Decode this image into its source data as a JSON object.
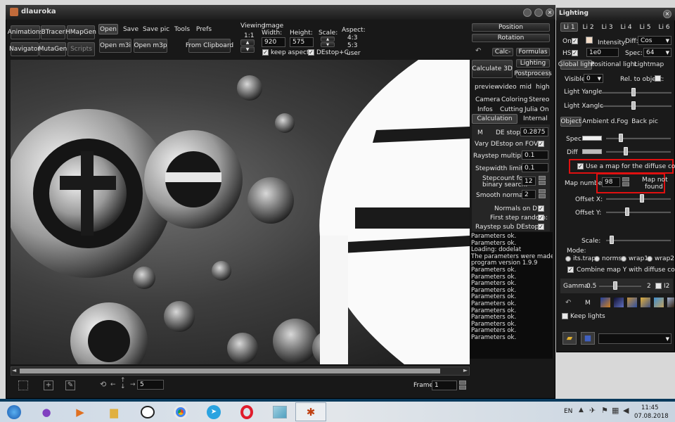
{
  "main": {
    "title": "dlauroka",
    "left_buttons": [
      "Animations",
      "BTracer",
      "HMapGen",
      "Navigator",
      "MutaGen",
      "Scripts"
    ],
    "menu": [
      "Open",
      "Save",
      "Save pic",
      "Tools",
      "Prefs"
    ],
    "open_m3i": "Open m3i",
    "open_m3p": "Open m3p",
    "clipboard": "From Clipboard",
    "viewing": "Viewing",
    "ratio": "1:1",
    "image": "Image",
    "width_lbl": "Width:",
    "width": "920",
    "height_lbl": "Height:",
    "height": "575",
    "scale_lbl": "Scale:",
    "keep_aspect": "keep aspect",
    "destop": "DEstop+C",
    "aspect_lbl": "Aspect:",
    "aspect_values": [
      "4:3",
      "5:3",
      "user"
    ],
    "position": "Position",
    "rotation": "Rotation",
    "calc": "Calc-",
    "formulas": "Formulas",
    "calc3d": "Calculate 3D",
    "lighting": "Lighting",
    "postprocess": "Postprocess",
    "preview_tabs": [
      "preview",
      "video",
      "mid",
      "high"
    ],
    "tabs_row1": [
      "Camera",
      "Coloring",
      "Stereo"
    ],
    "tabs_row2": [
      "Infos",
      "Cutting",
      "Julia On"
    ],
    "tabs_row3": [
      "Calculation",
      "Internal"
    ],
    "m": "M",
    "destop_lbl": "DE stop:",
    "destop_val": "0.2875",
    "vary_destop": "Vary DEstop on FOV:",
    "raystep_mult": "Raystep multiplier:",
    "raystep_mult_val": "0.1",
    "stepwidth": "Stepwidth limiter:",
    "stepwidth_val": "0.1",
    "stepcount": "Stepcount for",
    "binary": "binary search:",
    "stepcount_val": "12",
    "smooth": "Smooth normals:",
    "smooth_val": "2",
    "normals_de": "Normals on DE:",
    "first_step": "First step random:",
    "raystep_sub": "Raystep sub DEstop:",
    "log": [
      "Parameters ok.",
      "Parameters ok.",
      "Loading: dodelat",
      "The parameters were made with",
      "program version 1.9.9",
      "Parameters ok.",
      "Parameters ok.",
      "Parameters ok.",
      "Parameters ok.",
      "Parameters ok.",
      "Parameters ok.",
      "Parameters ok.",
      "Parameters ok.",
      "Parameters ok.",
      "Parameters ok.",
      "Parameters ok."
    ],
    "frame_lbl": "Frame:",
    "frame_val": "1",
    "nav_val": "5"
  },
  "lighting": {
    "title": "Lighting",
    "light_tabs": [
      "Li 1",
      "Li 2",
      "Li 3",
      "Li 4",
      "Li 5",
      "Li 6"
    ],
    "on": "On",
    "intensity": "Intensity:",
    "diff_lbl": "Diff:",
    "diff_val": "Cos",
    "hs": "HS",
    "hs_val": "1e0",
    "spec_lbl": "Spec:",
    "spec_val": "64",
    "sub_tabs": [
      "Global light",
      "Positional light",
      "Lightmap"
    ],
    "visible": "Visible:",
    "visible_val": "0",
    "rel_obj": "Rel. to object:",
    "light_y": "Light Yangle",
    "light_x": "Light Xangle",
    "obj_tabs": [
      "Object",
      "Ambient",
      "d.Fog",
      "Back pic"
    ],
    "spec": "Spec",
    "diff": "Diff",
    "use_map": "Use a map for the diffuse color",
    "map_number": "Map number",
    "map_val": "98",
    "map_not": "Map not",
    "found": "found",
    "offset_x": "Offset X:",
    "offset_y": "Offset Y:",
    "scale": "Scale:",
    "mode": "Mode:",
    "modes": [
      "its.trap",
      "norms",
      "wrap1",
      "wrap2"
    ],
    "combine": "Combine map Y with diffuse colors",
    "gamma": "Gamma:",
    "gamma_min": "0.5",
    "gamma_max": "2",
    "i2": "I2",
    "m": "M",
    "keep_lights": "Keep lights"
  },
  "taskbar": {
    "lang": "EN",
    "time": "11:45",
    "date": "07.08.2018"
  }
}
